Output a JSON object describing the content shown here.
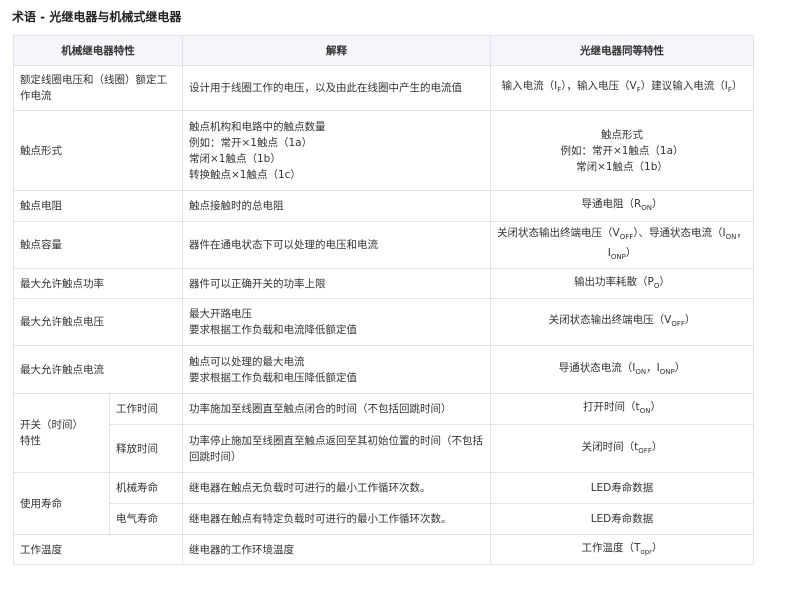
{
  "page_title": "术语 - 光继电器与机械式继电器",
  "headers": [
    "机械继电器特性",
    "解释",
    "光继电器同等特性"
  ],
  "rows": {
    "rated_coil": {
      "term": "额定线圈电压和（线圈）额定工作电流",
      "explain": "设计用于线圈工作的电压，以及由此在线圈中产生的电流值",
      "opto": {
        "t1": "输入电流（I",
        "s1": "F",
        "t2": "），输入电压（V",
        "s2": "F",
        "t3": "）建议输入电流（I",
        "s3": "F",
        "t4": "）"
      }
    },
    "contact_form": {
      "term": "触点形式",
      "explain": "触点机构和电路中的触点数量\n例如：常开×1触点（1a）\n常闭×1触点（1b）\n转换触点×1触点（1c）",
      "opto": "触点形式\n例如：常开×1触点（1a）\n常闭×1触点（1b）"
    },
    "contact_resistance": {
      "term": "触点电阻",
      "explain": "触点接触时的总电阻",
      "opto": {
        "t1": "导通电阻（R",
        "s1": "ON",
        "t2": "）"
      }
    },
    "contact_capacity": {
      "term": "触点容量",
      "explain": "器件在通电状态下可以处理的电压和电流",
      "opto": {
        "t1": "关闭状态输出终端电压（V",
        "s1": "OFF",
        "t2": "）、导通状态电流（I",
        "s2": "ON",
        "t3": "，I",
        "s3": "ONP",
        "t4": "）"
      }
    },
    "max_power": {
      "term": "最大允许触点功率",
      "explain": "器件可以正确开关的功率上限",
      "opto": {
        "t1": "输出功率耗散（P",
        "s1": "O",
        "t2": "）"
      }
    },
    "max_voltage": {
      "term": "最大允许触点电压",
      "explain": "最大开路电压\n要求根据工作负载和电流降低额定值",
      "opto": {
        "t1": "关闭状态输出终端电压（V",
        "s1": "OFF",
        "t2": "）"
      }
    },
    "max_current": {
      "term": "最大允许触点电流",
      "explain": "触点可以处理的最大电流\n要求根据工作负载和电压降低额定值",
      "opto": {
        "t1": "导通状态电流（I",
        "s1": "ON",
        "t2": "，I",
        "s2": "ONP",
        "t3": "）"
      }
    },
    "switching": {
      "group": "开关（时间）\n特性",
      "operate": {
        "term": "工作时间",
        "explain": "功率施加至线圈直至触点闭合的时间（不包括回跳时间）",
        "opto": {
          "t1": "打开时间（t",
          "s1": "ON",
          "t2": "）"
        }
      },
      "release": {
        "term": "释放时间",
        "explain": "功率停止施加至线圈直至触点返回至其初始位置的时间（不包括回跳时间）",
        "opto": {
          "t1": "关闭时间（t",
          "s1": "OFF",
          "t2": "）"
        }
      }
    },
    "life": {
      "group": "使用寿命",
      "mechanical": {
        "term": "机械寿命",
        "explain": "继电器在触点无负载时可进行的最小工作循环次数。",
        "opto": "LED寿命数据"
      },
      "electrical": {
        "term": "电气寿命",
        "explain": "继电器在触点有特定负载时可进行的最小工作循环次数。",
        "opto": "LED寿命数据"
      }
    },
    "temperature": {
      "term": "工作温度",
      "explain": "继电器的工作环境温度",
      "opto": {
        "t1": "工作温度（T",
        "s1": "opr",
        "t2": "）"
      }
    }
  }
}
